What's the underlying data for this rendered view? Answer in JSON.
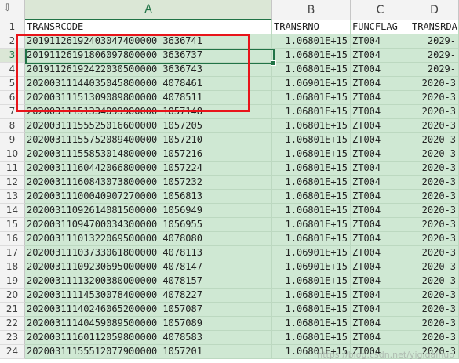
{
  "columns": [
    "A",
    "B",
    "C",
    "D"
  ],
  "selected_column": "A",
  "corner_icon": "select-all-arrow-icon",
  "rows": [
    {
      "n": "1",
      "a": "TRANSRCODE",
      "b": "TRANSRNO",
      "c": "FUNCFLAG",
      "d": "TRANSRDA"
    },
    {
      "n": "2",
      "a": "20191126192403047400000 3636741",
      "b": "1.06801E+15",
      "c": "ZT004",
      "d": "2029-"
    },
    {
      "n": "3",
      "a": "20191126191806097800000 3636737",
      "b": "1.06801E+15",
      "c": "ZT004",
      "d": "2029-"
    },
    {
      "n": "4",
      "a": "20191126192422030500000 3636743",
      "b": "1.06801E+15",
      "c": "ZT004",
      "d": "2029-"
    },
    {
      "n": "5",
      "a": "20200311144035045800000 4078461",
      "b": "1.06901E+15",
      "c": "ZT004",
      "d": "2020-3"
    },
    {
      "n": "6",
      "a": "20200311151309089800000 4078511",
      "b": "1.06801E+15",
      "c": "ZT004",
      "d": "2020-3"
    },
    {
      "n": "7",
      "a": "20200311151334099900000 1057148",
      "b": "1.06801E+15",
      "c": "ZT004",
      "d": "2020-3"
    },
    {
      "n": "8",
      "a": "20200311155525016600000 1057205",
      "b": "1.06801E+15",
      "c": "ZT004",
      "d": "2020-3"
    },
    {
      "n": "9",
      "a": "20200311155752089400000 1057210",
      "b": "1.06801E+15",
      "c": "ZT004",
      "d": "2020-3"
    },
    {
      "n": "10",
      "a": "20200311155853014800000 1057216",
      "b": "1.06801E+15",
      "c": "ZT004",
      "d": "2020-3"
    },
    {
      "n": "11",
      "a": "20200311160442066800000 1057224",
      "b": "1.06801E+15",
      "c": "ZT004",
      "d": "2020-3"
    },
    {
      "n": "12",
      "a": "20200311160843073800000 1057232",
      "b": "1.06801E+15",
      "c": "ZT004",
      "d": "2020-3"
    },
    {
      "n": "13",
      "a": "20200311100040907270000 1056813",
      "b": "1.06801E+15",
      "c": "ZT004",
      "d": "2020-3"
    },
    {
      "n": "14",
      "a": "20200311092614081500000 1056949",
      "b": "1.06801E+15",
      "c": "ZT004",
      "d": "2020-3"
    },
    {
      "n": "15",
      "a": "20200311094700034300000 1056955",
      "b": "1.06801E+15",
      "c": "ZT004",
      "d": "2020-3"
    },
    {
      "n": "16",
      "a": "20200311101322069500000 4078080",
      "b": "1.06801E+15",
      "c": "ZT004",
      "d": "2020-3"
    },
    {
      "n": "17",
      "a": "20200311103733061800000 4078113",
      "b": "1.06901E+15",
      "c": "ZT004",
      "d": "2020-3"
    },
    {
      "n": "18",
      "a": "20200311109230695000000 4078147",
      "b": "1.06901E+15",
      "c": "ZT004",
      "d": "2020-3"
    },
    {
      "n": "19",
      "a": "20200311113200380000000 4078157",
      "b": "1.06801E+15",
      "c": "ZT004",
      "d": "2020-3"
    },
    {
      "n": "20",
      "a": "20200311114530078400000 4078227",
      "b": "1.06801E+15",
      "c": "ZT004",
      "d": "2020-3"
    },
    {
      "n": "21",
      "a": "20200311140246065200000 1057087",
      "b": "1.06801E+15",
      "c": "ZT004",
      "d": "2020-3"
    },
    {
      "n": "22",
      "a": "20200311140459089500000 1057089",
      "b": "1.06801E+15",
      "c": "ZT004",
      "d": "2020-3"
    },
    {
      "n": "23",
      "a": "20200311160112059800000 4078583",
      "b": "1.06801E+15",
      "c": "ZT004",
      "d": "2020-3"
    },
    {
      "n": "24",
      "a": "20200311155512077900000 1057201",
      "b": "1.06801E+15",
      "c": "ZT004",
      "d": "2020-3"
    }
  ],
  "watermark": "https://blog.csdn.net/yigidaihuo"
}
